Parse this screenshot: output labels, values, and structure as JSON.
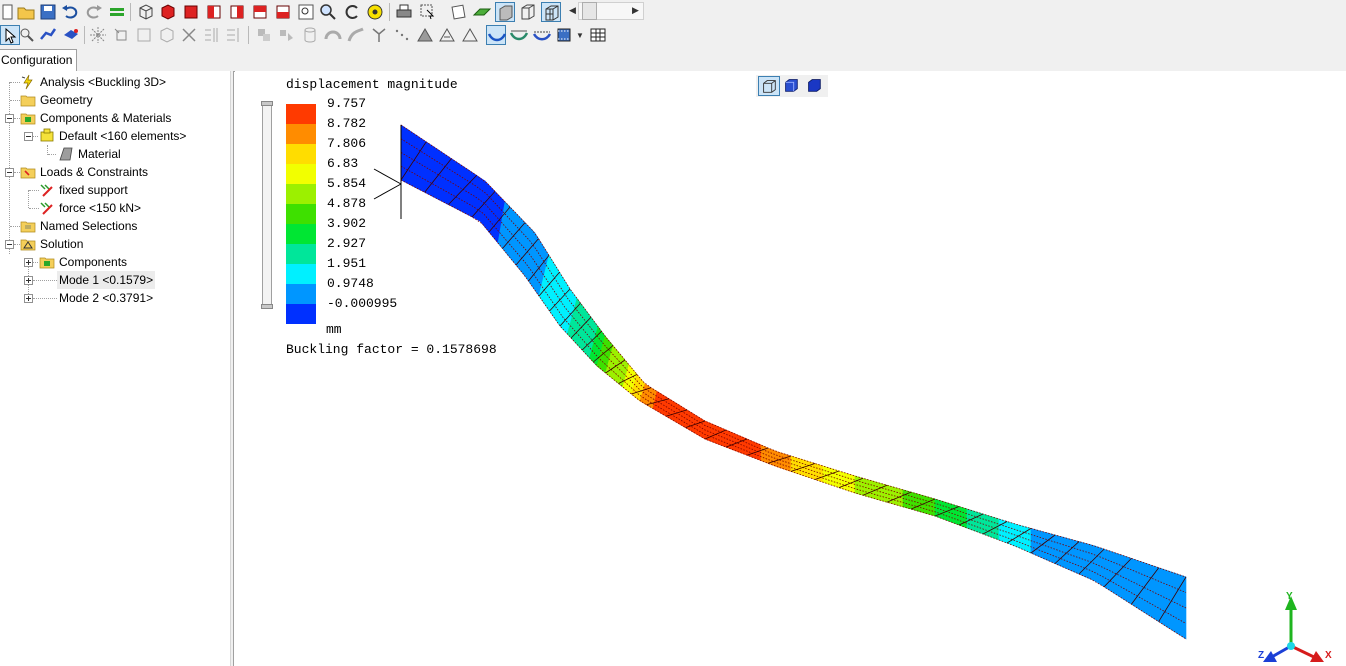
{
  "toolbar_top": {
    "icons": [
      "new-icon",
      "open-folder-icon",
      "save-icon",
      "undo-icon",
      "redo-icon",
      "equals-icon",
      "wireframe-cube-icon",
      "solid-cube-icon",
      "view-front-icon",
      "view-back-icon",
      "view-left-icon",
      "view-right-icon",
      "view-top-icon",
      "zoom-box-icon",
      "zoom-icon",
      "rotate-icon",
      "fit-icon",
      "print-icon",
      "select-mode-icon",
      "copy-icon",
      "plane-icon",
      "shaded-icon",
      "wireframe-icon",
      "hidden-line-icon"
    ]
  },
  "toolbar_bottom": {
    "icons": [
      "pointer-icon",
      "pick-icon",
      "measure-icon",
      "probe-icon",
      "explode-icon",
      "node-icon",
      "box-icon",
      "mesh-icon",
      "delete-icon",
      "split-icon",
      "align-icon",
      "group-icon",
      "ungroup-icon",
      "cylinder-icon",
      "torus-icon",
      "sweep-icon",
      "tree-icon",
      "dots-icon",
      "contour-icon",
      "triangle-icon",
      "triangle-outline-icon",
      "deformed-shape-icon",
      "undeformed-icon",
      "overlay-icon",
      "animate-icon",
      "table-icon"
    ]
  },
  "tabs": {
    "configuration": "Configuration"
  },
  "tree": {
    "analysis": "Analysis <Buckling 3D>",
    "geometry": "Geometry",
    "components_materials": "Components & Materials",
    "default_component": "Default <160 elements>",
    "material": "Material",
    "loads_constraints": "Loads & Constraints",
    "fixed_support": "fixed support",
    "force": "force <150 kN>",
    "named_selections": "Named Selections",
    "solution": "Solution",
    "components": "Components",
    "mode1": "Mode 1 <0.1579>",
    "mode2": "Mode 2 <0.3791>"
  },
  "viewport": {
    "legend_title": "displacement magnitude",
    "legend_values": [
      "9.757",
      "8.782",
      "7.806",
      "6.83",
      "5.854",
      "4.878",
      "3.902",
      "2.927",
      "1.951",
      "0.9748",
      "-0.000995"
    ],
    "legend_colors": [
      "#ff3a00",
      "#ff8c00",
      "#ffdd00",
      "#f2ff00",
      "#9cf000",
      "#3ee000",
      "#00e633",
      "#00e69a",
      "#00f0ff",
      "#0096ff",
      "#0030ff"
    ],
    "unit": "mm",
    "buckling_label": "Buckling factor = 0.1578698",
    "triad": {
      "y": "Y",
      "x": "X",
      "z": "Z"
    }
  }
}
